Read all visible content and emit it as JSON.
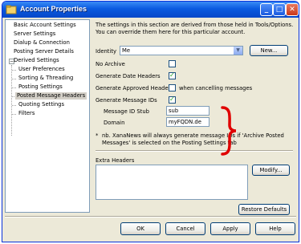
{
  "window": {
    "title": "Account Properties"
  },
  "titlebar": {
    "minimize": "_",
    "maximize": "□",
    "close": "✕"
  },
  "tree": {
    "items": [
      {
        "label": "Basic Account Settings"
      },
      {
        "label": "Server Settings"
      },
      {
        "label": "Dialup & Connection"
      },
      {
        "label": "Posting Server Details"
      },
      {
        "label": "Derived Settings",
        "expander": "−"
      },
      {
        "label": "User Preferences"
      },
      {
        "label": "Sorting & Threading"
      },
      {
        "label": "Posting Settings"
      },
      {
        "label": "Posted Message Headers",
        "selected": true
      },
      {
        "label": "Quoting Settings"
      },
      {
        "label": "Filters"
      }
    ]
  },
  "panel": {
    "info": "The settings in this section are derived from those held in Tools/Options.  You can override them here for this particular account.",
    "identity_label": "Identity",
    "identity_value": "Me",
    "new_button": "New...",
    "no_archive": {
      "label": "No Archive",
      "checked": false
    },
    "gen_date": {
      "label": "Generate Date Headers",
      "checked": true
    },
    "gen_approved": {
      "label": "Generate Approved Headers",
      "checked": false,
      "suffix": "when cancelling messages"
    },
    "gen_msgid": {
      "label": "Generate Message IDs",
      "checked": true
    },
    "msgid_stub_label": "Message ID Stub",
    "msgid_stub_value": "sub",
    "domain_label": "Domain",
    "domain_value": "myFQDN.de",
    "note_marker": "*",
    "note": "nb.  XanaNews will always generate message IDs if 'Archive Posted Messages' is selected on the Posting Settings tab",
    "extra_headers_label": "Extra Headers",
    "modify_button": "Modify...",
    "restore_button": "Restore Defaults"
  },
  "footer": {
    "ok": "OK",
    "cancel": "Cancel",
    "apply": "Apply",
    "help": "Help"
  },
  "colors": {
    "titlebar": "#0a5ae0",
    "accent_brace": "#e00000",
    "checkmark": "#21a121",
    "window_bg": "#ece9d8"
  }
}
